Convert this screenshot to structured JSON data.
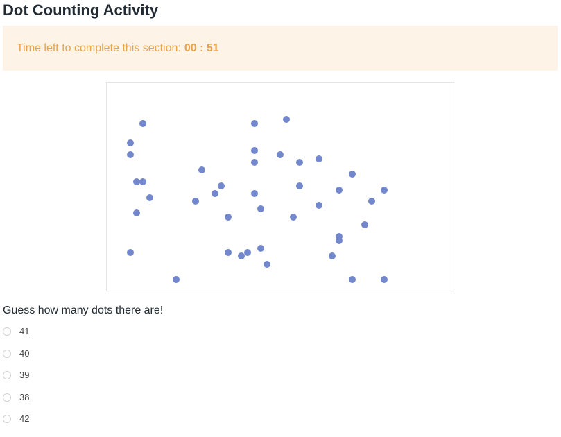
{
  "page": {
    "title": "Dot Counting Activity"
  },
  "timer": {
    "label": "Time left to complete this section:",
    "value": "00 : 51"
  },
  "dot_panel": {
    "dot_color": "#7387cc",
    "border_color": "#e4e4e4"
  },
  "question": {
    "text": "Guess how many dots there are!",
    "options": [
      "41",
      "40",
      "39",
      "38",
      "42"
    ],
    "selected": null
  },
  "colors": {
    "title": "#222b33",
    "timer_background": "#fdf3e7",
    "timer_text": "#e8a24a"
  }
}
